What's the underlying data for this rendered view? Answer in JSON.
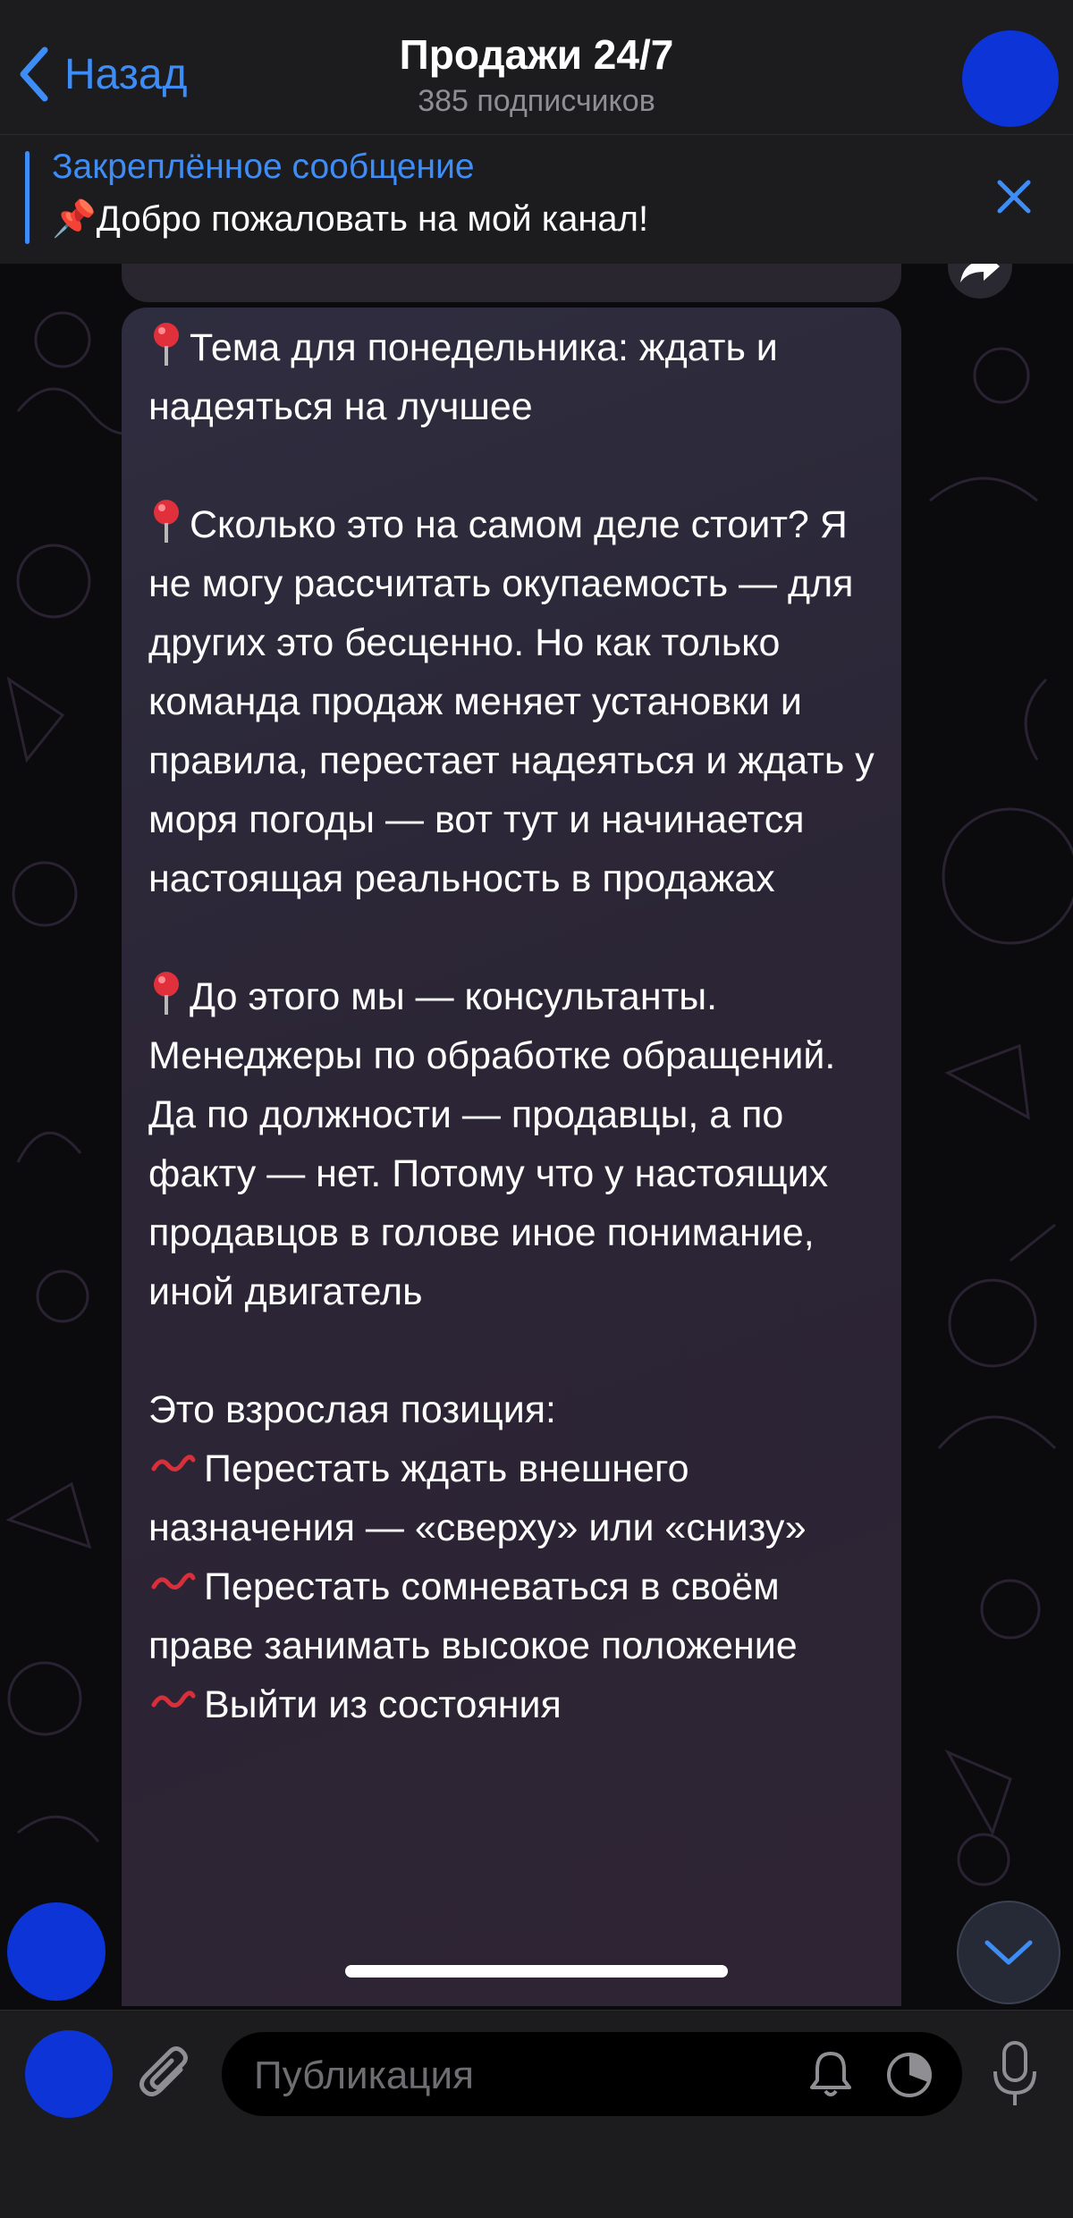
{
  "header": {
    "back_label": "Назад",
    "title": "Продажи 24/7",
    "subtitle": "385 подписчиков"
  },
  "pinned": {
    "title": "Закреплённое сообщение",
    "text": "📌Добро пожаловать на мой канал!"
  },
  "message": {
    "p1": "Тема для понедельника: ждать и надеяться на лучшее",
    "p2": "Сколько это на самом деле стоит? Я не могу рассчитать окупаемость — для других это бесценно. Но как только команда продаж меняет установки и правила, перестает надеяться и ждать у моря погоды — вот тут и начинается настоящая реальность в продажах",
    "p3": "До этого мы — консультанты. Менеджеры по обработке обращений. Да по должности — продавцы, а по факту — нет. Потому что у настоящих продавцов в голове иное понимание, иной двигатель",
    "p4_intro": "Это взрослая позиция:",
    "bullets": [
      "Перестать ждать внешнего назначения — «сверху» или «снизу»",
      "Перестать сомневаться в своём праве занимать высокое положение",
      "Выйти из состояния"
    ]
  },
  "composer": {
    "placeholder": "Публикация"
  },
  "colors": {
    "accent": "#3e8df6",
    "avatar": "#0d34d6",
    "bubble": "#2d2a3b"
  },
  "icons": [
    "chevron-left-icon",
    "close-icon",
    "pushpin-icon",
    "forward-icon",
    "chevron-down-icon",
    "paperclip-icon",
    "bell-icon",
    "timer-icon",
    "microphone-icon",
    "wave-icon"
  ]
}
